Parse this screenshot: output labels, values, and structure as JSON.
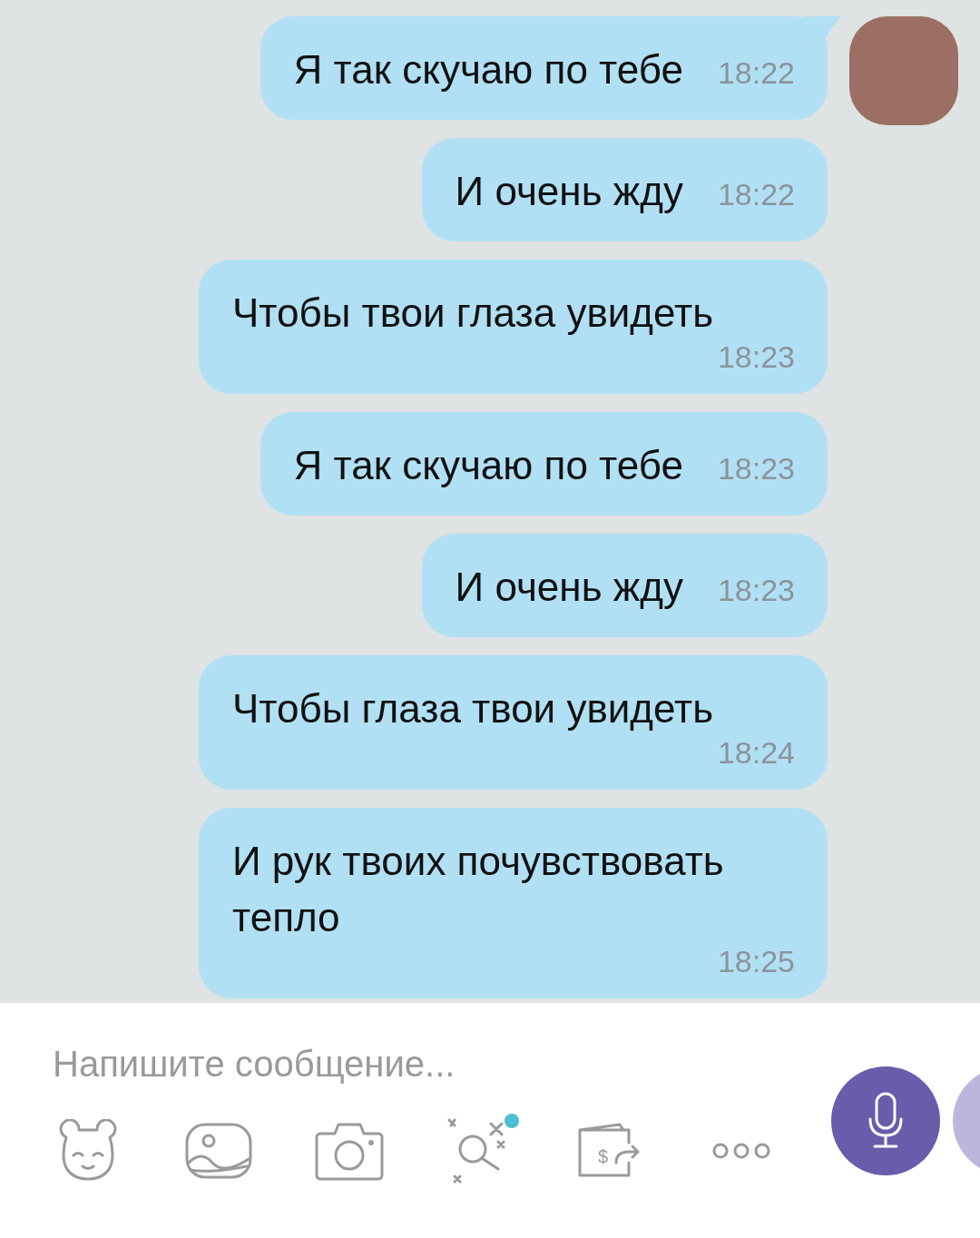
{
  "messages": [
    {
      "text": "Я так скучаю по тебе",
      "time": "18:22",
      "avatar": true
    },
    {
      "text": "И очень жду",
      "time": "18:22",
      "avatar": false
    },
    {
      "text": "Чтобы твои глаза увидеть",
      "time": "18:23",
      "avatar": false
    },
    {
      "text": "Я так скучаю по тебе",
      "time": "18:23",
      "avatar": false
    },
    {
      "text": "И очень жду",
      "time": "18:23",
      "avatar": false
    },
    {
      "text": "Чтобы глаза твои увидеть",
      "time": "18:24",
      "avatar": false
    },
    {
      "text": "И рук твоих почувствовать тепло",
      "time": "18:25",
      "avatar": false
    }
  ],
  "composer": {
    "placeholder": "Напишите сообщение...",
    "tools": [
      {
        "kind": "sticker",
        "badge": false
      },
      {
        "kind": "gallery",
        "badge": false
      },
      {
        "kind": "camera",
        "badge": false
      },
      {
        "kind": "doodle",
        "badge": true
      },
      {
        "kind": "money",
        "badge": false,
        "symbol": "$"
      },
      {
        "kind": "more",
        "badge": false
      }
    ]
  }
}
